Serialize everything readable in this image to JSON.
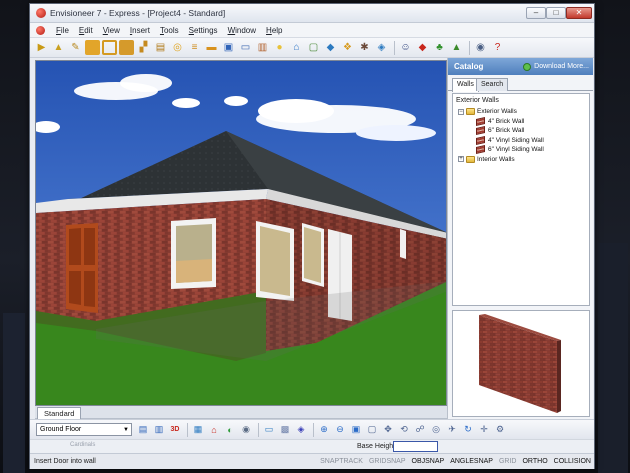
{
  "window": {
    "title": "Envisioneer 7 - Express - [Project4 - Standard]",
    "minimize": "–",
    "maximize": "□",
    "close": "✕"
  },
  "menu": [
    "File",
    "Edit",
    "View",
    "Insert",
    "Tools",
    "Settings",
    "Window",
    "Help"
  ],
  "view_tabs": {
    "active": "Standard"
  },
  "catalog": {
    "title": "Catalog",
    "download": "Download More...",
    "tabs": [
      "Walls",
      "Search"
    ],
    "section": "Exterior Walls",
    "tree": {
      "exterior": "Exterior Walls",
      "items": [
        "4\" Brick Wall",
        "6\" Brick Wall",
        "4\" Vinyl Siding Wall",
        "6\" Vinyl Siding Wall"
      ],
      "interior": "Interior Walls"
    }
  },
  "bottom": {
    "floor": "Ground Floor",
    "cardinal_hint": "Cardinals",
    "base_height_label": "Base Height",
    "base_height_value": ""
  },
  "status": {
    "message": "Insert Door into wall",
    "snaps": [
      {
        "label": "SNAPTRACK",
        "on": false
      },
      {
        "label": "GRIDSNAP",
        "on": false
      },
      {
        "label": "OBJSNAP",
        "on": true
      },
      {
        "label": "ANGLESNAP",
        "on": true
      },
      {
        "label": "GRID",
        "on": false
      },
      {
        "label": "ORTHO",
        "on": true
      },
      {
        "label": "COLLISION",
        "on": true
      }
    ]
  },
  "colors": {
    "sky": "#2f5fbf",
    "grass": "#3d8f1e",
    "brick": "#8b3b32",
    "roof": "#2e3336",
    "door": "#b04a1c",
    "catalog_header": "#5b88c4"
  },
  "toolbar_icons": [
    "select-icon",
    "wall-icon",
    "floor-icon",
    "door-icon",
    "window-icon",
    "cabinet-icon",
    "stair-icon",
    "furniture-icon",
    "appliance-icon",
    "plumbing-icon",
    "lighting-icon",
    "electrical-icon",
    "monitor-icon",
    "fireplace-icon",
    "bulb-icon",
    "roof-icon",
    "dormer-icon",
    "terrain-icon",
    "landscape-icon",
    "person-icon",
    "gem-icon",
    "tree-icon",
    "pool-icon",
    "camera-icon",
    "help-icon"
  ]
}
